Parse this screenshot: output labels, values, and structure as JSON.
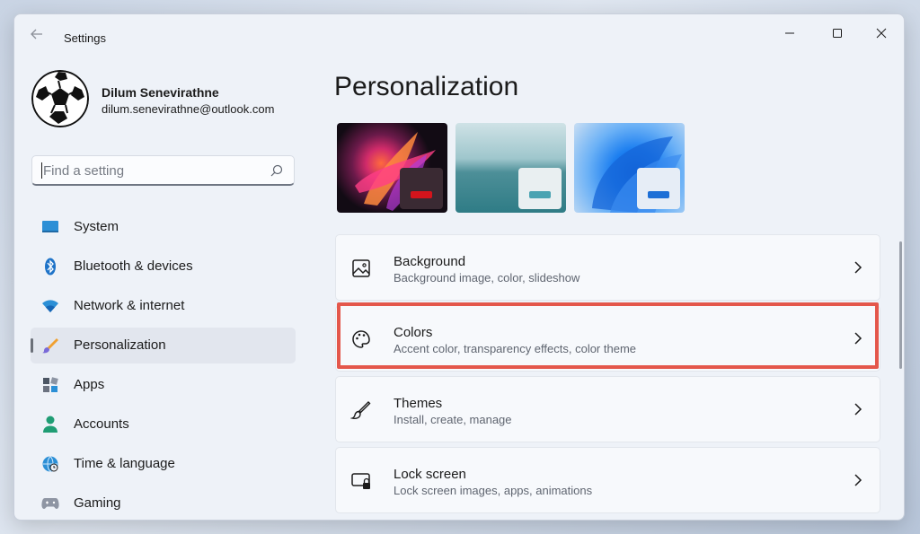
{
  "app": {
    "title": "Settings"
  },
  "user": {
    "name": "Dilum Senevirathne",
    "email": "dilum.senevirathne@outlook.com"
  },
  "search": {
    "placeholder": "Find a setting",
    "value": ""
  },
  "sidebar": {
    "items": [
      {
        "label": "System",
        "icon": "system-icon",
        "active": false
      },
      {
        "label": "Bluetooth & devices",
        "icon": "bluetooth-icon",
        "active": false
      },
      {
        "label": "Network & internet",
        "icon": "network-icon",
        "active": false
      },
      {
        "label": "Personalization",
        "icon": "personalization-icon",
        "active": true
      },
      {
        "label": "Apps",
        "icon": "apps-icon",
        "active": false
      },
      {
        "label": "Accounts",
        "icon": "accounts-icon",
        "active": false
      },
      {
        "label": "Time & language",
        "icon": "time-language-icon",
        "active": false
      },
      {
        "label": "Gaming",
        "icon": "gaming-icon",
        "active": false
      }
    ]
  },
  "main": {
    "title": "Personalization",
    "themes": [
      {
        "name": "dark-flower-theme",
        "accent": "#d4141c"
      },
      {
        "name": "lake-theme",
        "accent": "#4aa3b2"
      },
      {
        "name": "windows-bloom-theme",
        "accent": "#1d6fd6"
      }
    ],
    "cards": [
      {
        "title": "Background",
        "subtitle": "Background image, color, slideshow",
        "icon": "image-icon"
      },
      {
        "title": "Colors",
        "subtitle": "Accent color, transparency effects, color theme",
        "icon": "palette-icon"
      },
      {
        "title": "Themes",
        "subtitle": "Install, create, manage",
        "icon": "brush-icon"
      },
      {
        "title": "Lock screen",
        "subtitle": "Lock screen images, apps, animations",
        "icon": "lock-screen-icon"
      }
    ]
  },
  "colors": {
    "highlight": "#e4574b",
    "active_nav": "#e2e6ee"
  }
}
